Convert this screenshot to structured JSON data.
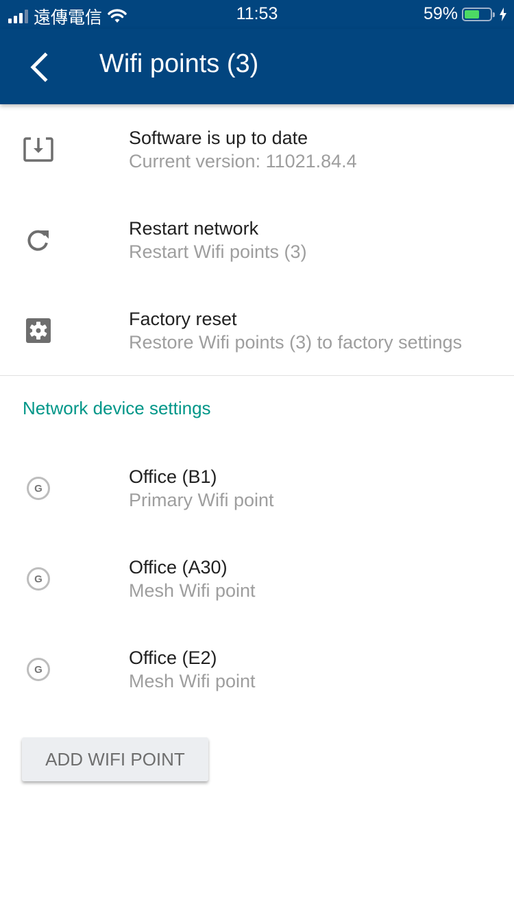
{
  "status_bar": {
    "carrier": "遠傳電信",
    "time": "11:53",
    "battery_percent": "59%",
    "battery_level": 0.59,
    "battery_color": "#4cd964",
    "charging": true
  },
  "app_bar": {
    "title": "Wifi points (3)",
    "background": "#02457f"
  },
  "actions": [
    {
      "icon": "system-update-icon",
      "title": "Software is up to date",
      "subtitle": "Current version: 11021.84.4"
    },
    {
      "icon": "refresh-icon",
      "title": "Restart network",
      "subtitle": "Restart Wifi points (3)"
    },
    {
      "icon": "settings-box-icon",
      "title": "Factory reset",
      "subtitle": "Restore Wifi points (3) to factory settings"
    }
  ],
  "section": {
    "title": "Network device settings",
    "color": "#009688"
  },
  "devices": [
    {
      "icon_letter": "G",
      "name": "Office (B1)",
      "role": "Primary Wifi point"
    },
    {
      "icon_letter": "G",
      "name": "Office (A30)",
      "role": "Mesh Wifi point"
    },
    {
      "icon_letter": "G",
      "name": "Office (E2)",
      "role": "Mesh Wifi point"
    }
  ],
  "add_button": {
    "label": "ADD WIFI POINT"
  }
}
